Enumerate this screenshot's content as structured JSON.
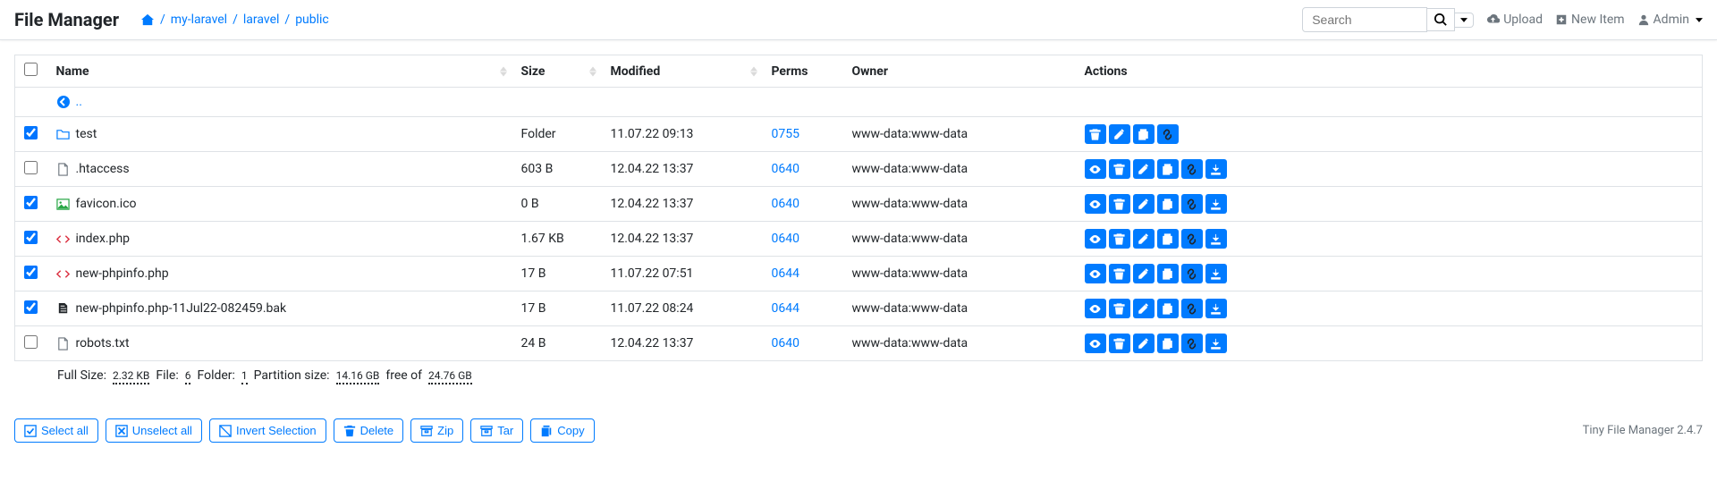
{
  "brand": "File Manager",
  "breadcrumb": [
    "my-laravel",
    "laravel",
    "public"
  ],
  "search": {
    "placeholder": "Search"
  },
  "nav": {
    "upload": "Upload",
    "newitem": "New Item",
    "admin": "Admin"
  },
  "columns": {
    "name": "Name",
    "size": "Size",
    "modified": "Modified",
    "perms": "Perms",
    "owner": "Owner",
    "actions": "Actions"
  },
  "parent_label": "..",
  "rows": [
    {
      "checked": true,
      "icon": "folder",
      "name": "test",
      "size": "Folder",
      "modified": "11.07.22 09:13",
      "perms": "0755",
      "owner": "www-data:www-data",
      "actions": [
        "delete",
        "rename",
        "copy",
        "link"
      ]
    },
    {
      "checked": false,
      "icon": "file",
      "name": ".htaccess",
      "size": "603 B",
      "modified": "12.04.22 13:37",
      "perms": "0640",
      "owner": "www-data:www-data",
      "actions": [
        "view",
        "delete",
        "rename",
        "copy",
        "link",
        "download"
      ]
    },
    {
      "checked": true,
      "icon": "image",
      "name": "favicon.ico",
      "size": "0 B",
      "modified": "12.04.22 13:37",
      "perms": "0640",
      "owner": "www-data:www-data",
      "actions": [
        "view",
        "delete",
        "rename",
        "copy",
        "link",
        "download"
      ]
    },
    {
      "checked": true,
      "icon": "code",
      "name": "index.php",
      "size": "1.67 KB",
      "modified": "12.04.22 13:37",
      "perms": "0640",
      "owner": "www-data:www-data",
      "actions": [
        "view",
        "delete",
        "rename",
        "copy",
        "link",
        "download"
      ]
    },
    {
      "checked": true,
      "icon": "code",
      "name": "new-phpinfo.php",
      "size": "17 B",
      "modified": "11.07.22 07:51",
      "perms": "0644",
      "owner": "www-data:www-data",
      "actions": [
        "view",
        "delete",
        "rename",
        "copy",
        "link",
        "download"
      ]
    },
    {
      "checked": true,
      "icon": "file-copy",
      "name": "new-phpinfo.php-11Jul22-082459.bak",
      "size": "17 B",
      "modified": "11.07.22 08:24",
      "perms": "0644",
      "owner": "www-data:www-data",
      "actions": [
        "view",
        "delete",
        "rename",
        "copy",
        "link",
        "download"
      ]
    },
    {
      "checked": false,
      "icon": "file",
      "name": "robots.txt",
      "size": "24 B",
      "modified": "12.04.22 13:37",
      "perms": "0640",
      "owner": "www-data:www-data",
      "actions": [
        "view",
        "delete",
        "rename",
        "copy",
        "link",
        "download"
      ]
    }
  ],
  "summary": {
    "full_size_label": "Full Size:",
    "full_size": "2.32 KB",
    "file_label": "File:",
    "file_count": "6",
    "folder_label": "Folder:",
    "folder_count": "1",
    "partition_label": "Partition size:",
    "partition_used": "14.16 GB",
    "free_of": "free of",
    "partition_total": "24.76 GB"
  },
  "bulk": {
    "select_all": "Select all",
    "unselect_all": "Unselect all",
    "invert": "Invert Selection",
    "delete": "Delete",
    "zip": "Zip",
    "tar": "Tar",
    "copy": "Copy"
  },
  "footer": "Tiny File Manager 2.4.7"
}
